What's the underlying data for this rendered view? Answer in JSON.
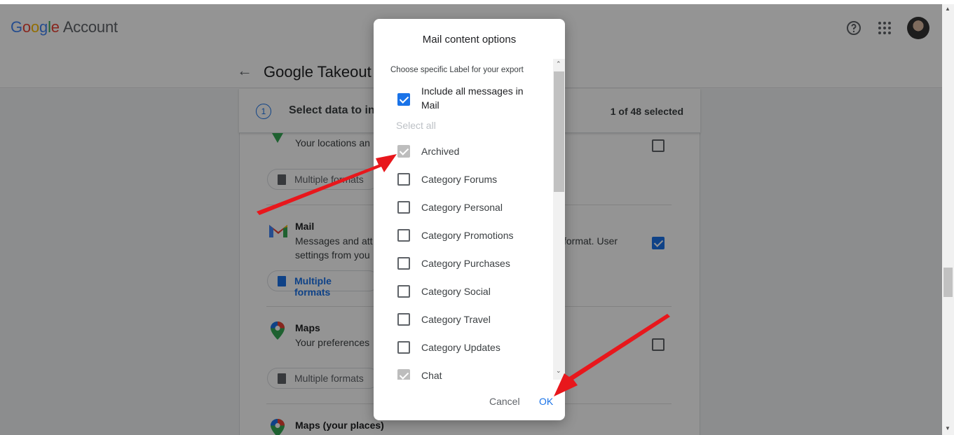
{
  "header": {
    "logo_google": "Google",
    "logo_account": "Account",
    "help_icon": "help-icon",
    "apps_icon": "apps-grid-icon",
    "avatar_icon": "avatar"
  },
  "page": {
    "title": "Google Takeout",
    "step_number": "1",
    "step_title": "Select data to in",
    "selected_count": "1 of 48 selected"
  },
  "products": [
    {
      "name": "",
      "desc_line1": "Your locations an",
      "format": "Multiple formats",
      "checked": false
    },
    {
      "name": "Mail",
      "desc_line1": "Messages and att",
      "desc_line1_right": "format. User",
      "desc_line2": "settings from you",
      "format": "Multiple formats",
      "checked": true
    },
    {
      "name": "Maps",
      "desc_line1": "Your preferences",
      "format": "Multiple formats",
      "checked": false
    },
    {
      "name": "Maps (your places)"
    }
  ],
  "dialog": {
    "title": "Mail content options",
    "subtitle": "Choose specific Label for your export",
    "include_all": "Include all messages in Mail",
    "select_all": "Select all",
    "labels": [
      {
        "text": "Archived",
        "state": "disabled"
      },
      {
        "text": "Category Forums",
        "state": "unchecked"
      },
      {
        "text": "Category Personal",
        "state": "unchecked"
      },
      {
        "text": "Category Promotions",
        "state": "unchecked"
      },
      {
        "text": "Category Purchases",
        "state": "unchecked"
      },
      {
        "text": "Category Social",
        "state": "unchecked"
      },
      {
        "text": "Category Travel",
        "state": "unchecked"
      },
      {
        "text": "Category Updates",
        "state": "unchecked"
      },
      {
        "text": "Chat",
        "state": "disabled"
      }
    ],
    "cancel": "Cancel",
    "ok": "OK"
  },
  "colors": {
    "accent": "#1a73e8",
    "annotation_arrow": "#e8171c"
  }
}
